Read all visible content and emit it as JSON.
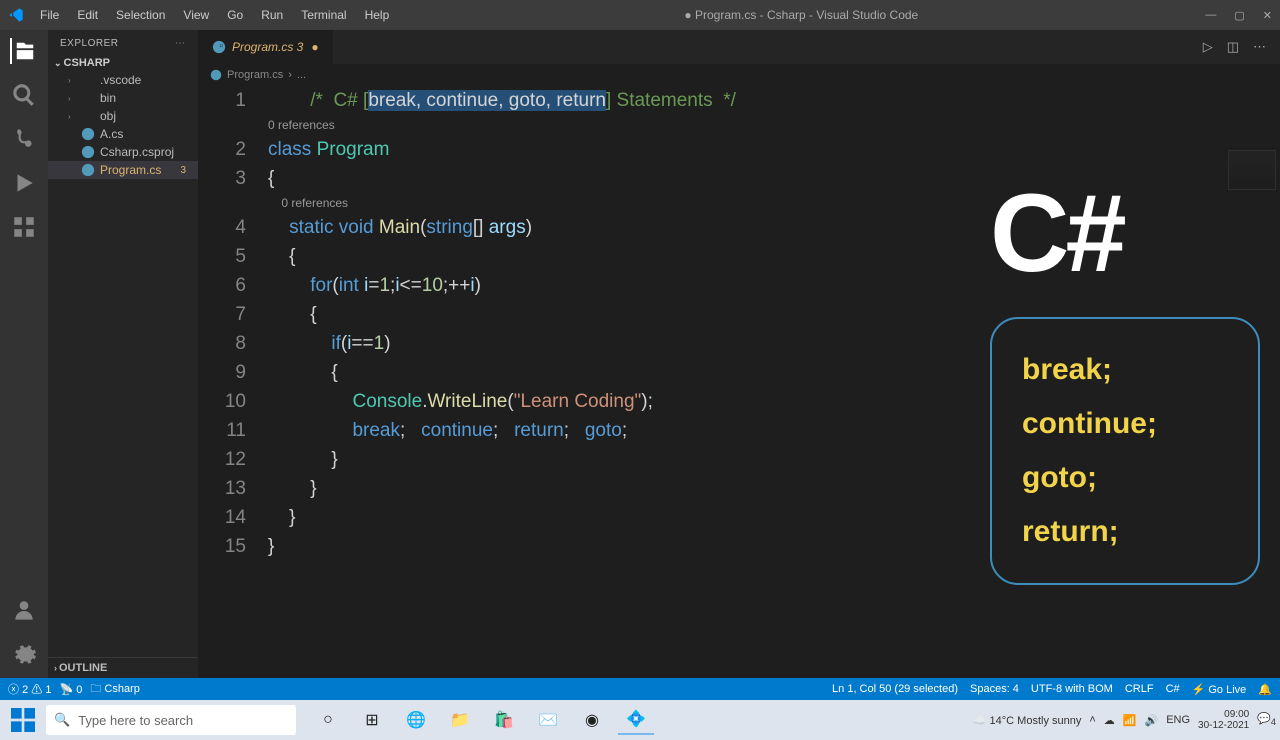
{
  "window": {
    "title": "● Program.cs - Csharp - Visual Studio Code"
  },
  "menu": [
    "File",
    "Edit",
    "Selection",
    "View",
    "Go",
    "Run",
    "Terminal",
    "Help"
  ],
  "sidebar": {
    "title": "EXPLORER",
    "folder": "CSHARP",
    "tree": [
      {
        "icon": "chev",
        "label": ".vscode"
      },
      {
        "icon": "chev",
        "label": "bin"
      },
      {
        "icon": "chev",
        "label": "obj"
      },
      {
        "icon": "cs",
        "label": "A.cs"
      },
      {
        "icon": "csp",
        "label": "Csharp.csproj"
      },
      {
        "icon": "cs",
        "label": "Program.cs",
        "active": true,
        "badge": "3"
      }
    ],
    "outline": "OUTLINE"
  },
  "tab": {
    "label": "Program.cs 3",
    "breadcrumb_file": "Program.cs",
    "breadcrumb_more": "..."
  },
  "code": {
    "codelens": "0 references",
    "line_numbers": [
      "1",
      "2",
      "3",
      "4",
      "5",
      "6",
      "7",
      "8",
      "9",
      "10",
      "11",
      "12",
      "13",
      "14",
      "15"
    ],
    "l1_a": "/*  C# [",
    "l1_b": "break, continue, goto, return",
    "l1_c": "] Statements  */",
    "class_kw": "class",
    "class_name": "Program",
    "static_kw": "static",
    "void_kw": "void",
    "main": "Main",
    "string_kw": "string",
    "args": "args",
    "for_kw": "for",
    "int_kw": "int",
    "if_kw": "if",
    "console": "Console",
    "writeline": "WriteLine",
    "str": "\"Learn Coding\"",
    "break_kw": "break",
    "continue_kw": "continue",
    "return_kw": "return",
    "goto_kw": "goto"
  },
  "overlay": {
    "title": "C#",
    "items": [
      "break;",
      "continue;",
      "goto;",
      "return;"
    ]
  },
  "status": {
    "errors": "2",
    "warnings": "1",
    "ports": "0",
    "folder": "Csharp",
    "ln": "Ln 1, Col 50 (29 selected)",
    "spaces": "Spaces: 4",
    "enc": "UTF-8 with BOM",
    "eol": "CRLF",
    "lang": "C#",
    "golive": "⚡ Go Live",
    "bell": "🔔"
  },
  "taskbar": {
    "search_placeholder": "Type here to search",
    "weather": "14°C  Mostly sunny",
    "lang": "ENG",
    "time": "09:00",
    "date": "30-12-2021",
    "notif": "4"
  }
}
